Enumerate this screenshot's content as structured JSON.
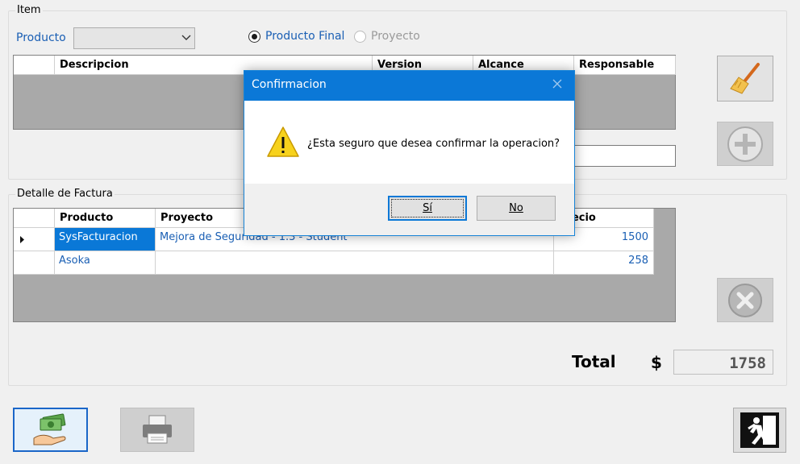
{
  "item_group": {
    "title": "Item",
    "producto_label": "Producto",
    "producto_value": "",
    "radio_final": "Producto Final",
    "radio_proyecto": "Proyecto",
    "radio_selected": "Producto Final",
    "table": {
      "columns": [
        "Descripcion",
        "Version",
        "Alcance",
        "Responsable"
      ],
      "rows": []
    },
    "text_input": ""
  },
  "detalle_group": {
    "title": "Detalle de Factura",
    "table": {
      "columns": [
        "Producto",
        "Proyecto",
        "Precio"
      ],
      "rows": [
        {
          "producto": "SysFacturacion",
          "proyecto": "Mejora de Seguridad - 1.3 - Student",
          "precio": "1500"
        },
        {
          "producto": "Asoka",
          "proyecto": "",
          "precio": "258"
        }
      ]
    }
  },
  "total": {
    "label": "Total",
    "currency": "$",
    "value": "1758"
  },
  "dialog": {
    "title": "Confirmacion",
    "message": "¿Esta seguro que desea confirmar la operacion?",
    "yes_label": "Sí",
    "no_label": "No",
    "icon": "warning-icon"
  },
  "icons": {
    "clear": "broom-icon",
    "add": "plus-circle-icon",
    "remove": "x-circle-icon",
    "pay": "money-hand-icon",
    "print": "printer-icon",
    "exit": "emergency-exit-icon"
  },
  "colors": {
    "accent": "#0b78d7",
    "link_text": "#1a5fb4",
    "grid_bg": "#a9a9a9"
  }
}
